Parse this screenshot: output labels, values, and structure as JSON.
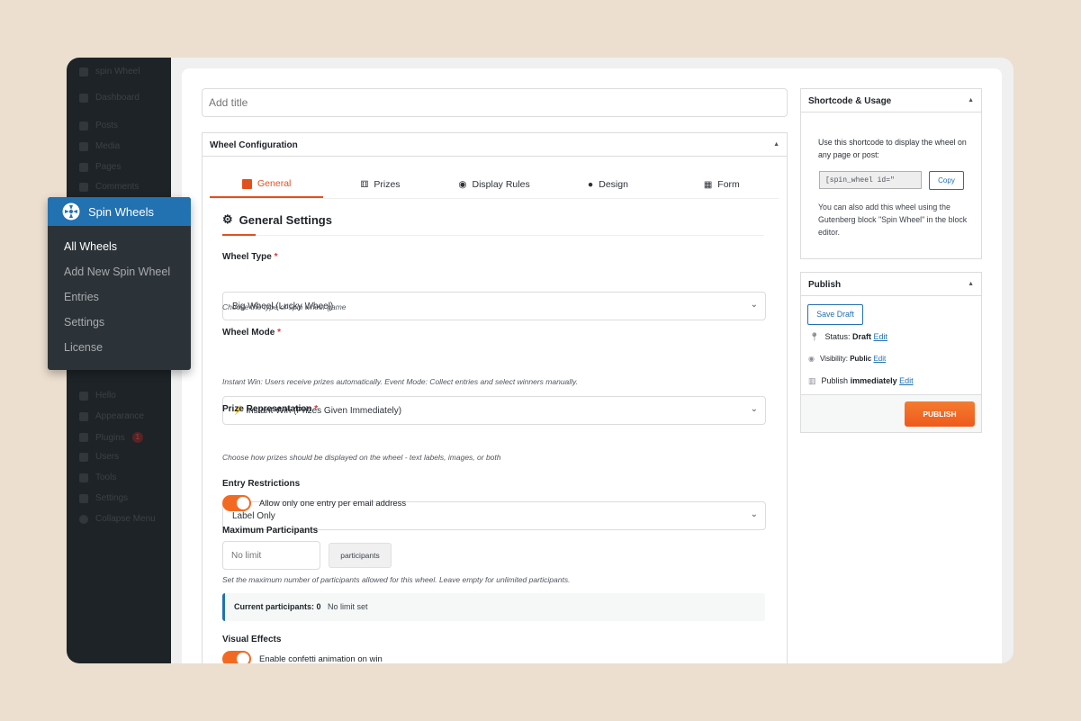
{
  "wp_sidebar": {
    "site": "spin Wheel",
    "items": [
      "Dashboard",
      "Posts",
      "Media",
      "Pages",
      "Comments",
      "Hello",
      "Appearance",
      "Plugins",
      "Users",
      "Tools",
      "Settings",
      "Collapse Menu"
    ],
    "plugins_badge": "1"
  },
  "flyout": {
    "title": "Spin Wheels",
    "items": [
      "All Wheels",
      "Add New Spin Wheel",
      "Entries",
      "Settings",
      "License"
    ]
  },
  "title_placeholder": "Add title",
  "config": {
    "title": "Wheel Configuration",
    "tabs": [
      "General",
      "Prizes",
      "Display Rules",
      "Design",
      "Form"
    ],
    "section_title": "General Settings",
    "wheel_type": {
      "label": "Wheel Type",
      "value": "Big Wheel (Lucky Wheel)",
      "help": "Choose the type of spin wheel game"
    },
    "wheel_mode": {
      "label": "Wheel Mode",
      "value": "⚡ Instant Win (Prizes Given Immediately)",
      "help": "Instant Win: Users receive prizes automatically. Event Mode: Collect entries and select winners manually."
    },
    "prize_rep": {
      "label": "Prize Representation",
      "value": "Label Only",
      "help": "Choose how prizes should be displayed on the wheel - text labels, images, or both"
    },
    "entry": {
      "label": "Entry Restrictions",
      "toggle": "Allow only one entry per email address",
      "on": true
    },
    "max": {
      "label": "Maximum Participants",
      "placeholder": "No limit",
      "unit": "participants",
      "help": "Set the maximum number of participants allowed for this wheel. Leave empty for unlimited participants.",
      "current_label": "Current participants: 0",
      "current_note": "No limit set"
    },
    "visual": {
      "label": "Visual Effects",
      "toggle": "Enable confetti animation on win",
      "on": true
    },
    "required_mark": "*"
  },
  "shortcode": {
    "title": "Shortcode & Usage",
    "intro": "Use this shortcode to display the wheel on any page or post:",
    "code": "[spin_wheel id=\"",
    "copy": "Copy",
    "note": "You can also add this wheel using the Gutenberg block \"Spin Wheel\" in the block editor."
  },
  "publish": {
    "title": "Publish",
    "save_draft": "Save Draft",
    "status_label": "Status:",
    "status": "Draft",
    "visibility_label": "Visibility:",
    "visibility": "Public",
    "publish_label": "Publish",
    "publish_when": "immediately",
    "edit": "Edit",
    "button": "PUBLISH"
  },
  "colors": {
    "accent": "#f26a22",
    "wp_blue": "#2271b1"
  }
}
